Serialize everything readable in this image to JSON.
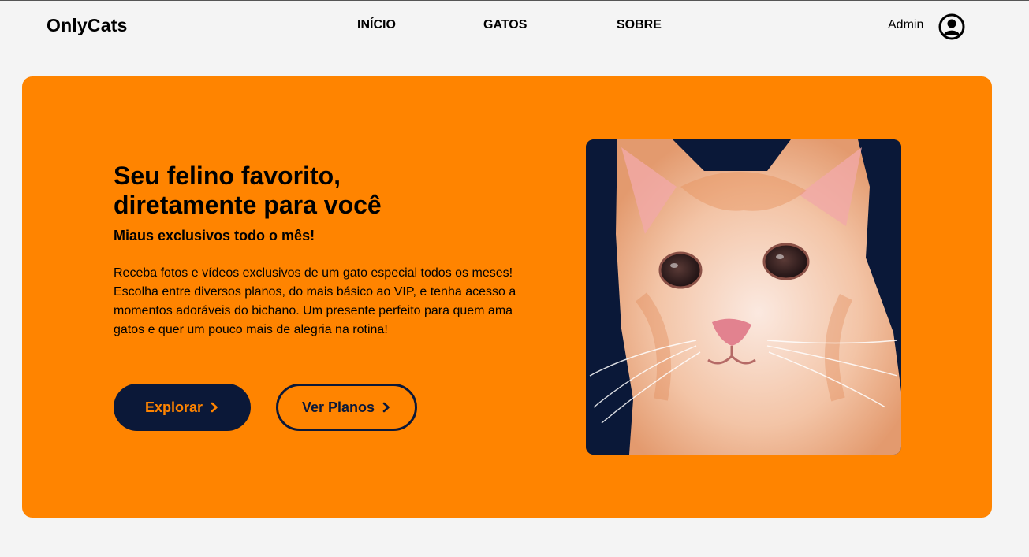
{
  "navbar": {
    "brand": "OnlyCats",
    "links": [
      "INÍCIO",
      "GATOS",
      "SOBRE"
    ],
    "user_label": "Admin",
    "user_icon": "account-circle-icon"
  },
  "hero": {
    "title": "Seu felino favorito, diretamente para você",
    "subtitle": "Miaus exclusivos todo o mês!",
    "description": "Receba fotos e vídeos exclusivos de um gato especial todos os meses! Escolha entre diversos planos, do mais básico ao VIP, e tenha acesso a momentos adoráveis do bichano. Um presente perfeito para quem ama gatos e quer um pouco mais de alegria na rotina!",
    "primary_button": "Explorar",
    "secondary_button": "Ver Planos",
    "button_icon": "chevron-right-icon",
    "image": "orange-cat-photo"
  },
  "colors": {
    "accent": "#ff8400",
    "dark": "#0b1838",
    "background": "#f4f4f4"
  }
}
